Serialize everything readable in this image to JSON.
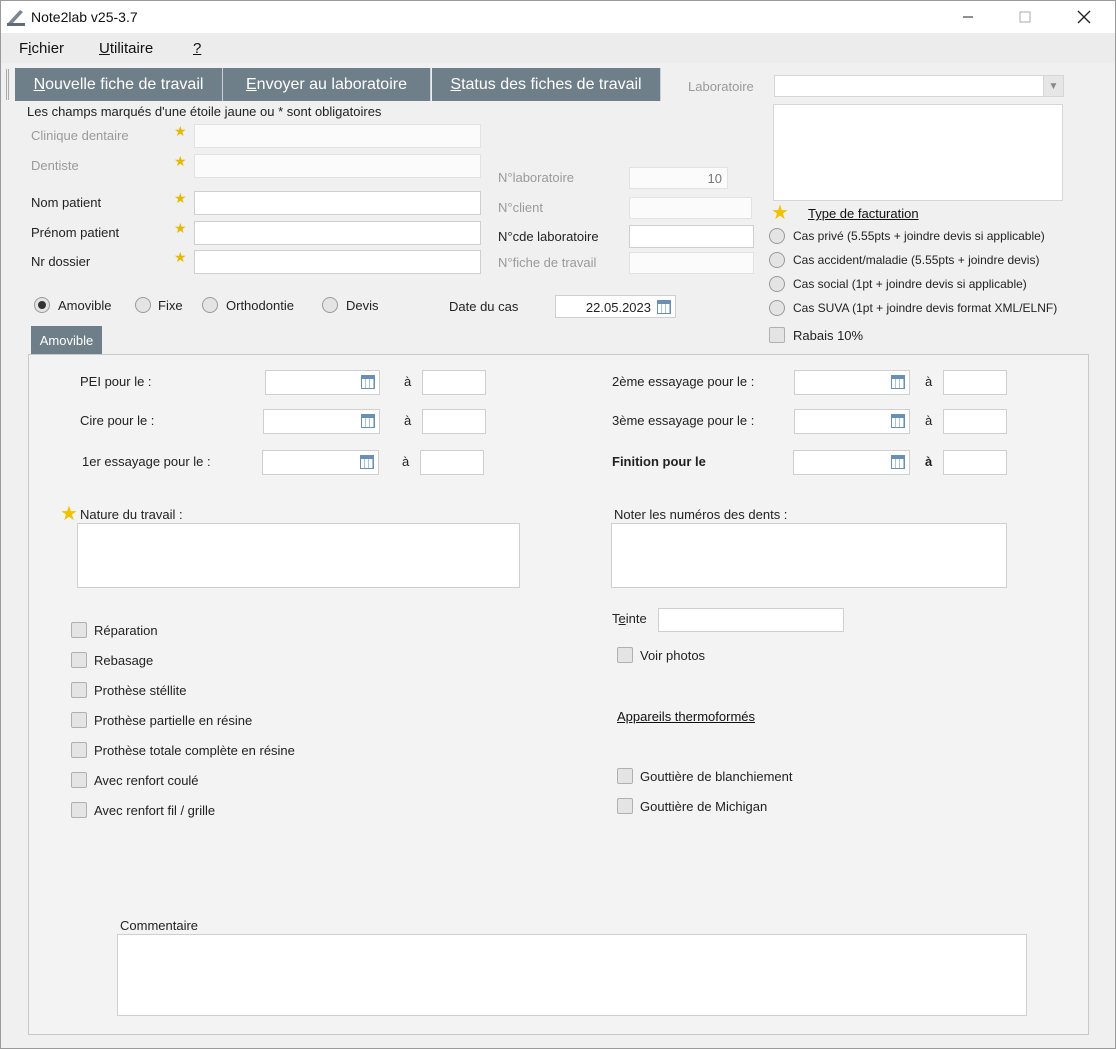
{
  "window": {
    "title": "Note2lab v25-3.7",
    "minimize": "—",
    "maximize": "☐",
    "close": "✕"
  },
  "menu": {
    "fichier_pre": "F",
    "fichier_u": "i",
    "fichier_post": "chier",
    "utilitaire_u": "U",
    "utilitaire_post": "tilitaire",
    "help": "?"
  },
  "tabs": [
    {
      "u": "N",
      "rest": "ouvelle fiche de travail"
    },
    {
      "u": "E",
      "rest": "nvoyer au laboratoire"
    },
    {
      "u": "S",
      "rest": "tatus des fiches de travail"
    }
  ],
  "notice": "Les champs marqués d'une étoile jaune ou * sont obligatoires",
  "fields": {
    "clinique": "Clinique dentaire",
    "dentiste": "Dentiste",
    "nom": "Nom patient",
    "prenom": "Prénom patient",
    "dossier": "Nr dossier",
    "nlabo": "N°laboratoire",
    "nlabo_value": "10",
    "nclient": "N°client",
    "ncde": "N°cde laboratoire",
    "nfiche": "N°fiche de travail",
    "laboratoire": "Laboratoire"
  },
  "facturation": {
    "title": "Type de facturation",
    "options": [
      "Cas privé  (5.55pts + joindre devis si applicable)",
      "Cas accident/maladie (5.55pts + joindre devis)",
      "Cas social (1pt + joindre devis si applicable)",
      "Cas SUVA (1pt + joindre devis format XML/ELNF)"
    ],
    "rabais": "Rabais 10%"
  },
  "work_type": {
    "options": [
      "Amovible",
      "Fixe",
      "Orthodontie",
      "Devis"
    ],
    "selected": "Amovible"
  },
  "date": {
    "label": "Date du cas",
    "value": "22.05.2023"
  },
  "subtab": "Amovible",
  "schedule": {
    "pei": "PEI pour le :",
    "cire": "Cire pour le :",
    "essai1": "1er essayage pour le :",
    "essai2": "2ème essayage pour le :",
    "essai3": "3ème essayage pour le :",
    "finition": "Finition pour le",
    "a": "à"
  },
  "nature": "Nature du travail :",
  "dents": "Noter les numéros des dents :",
  "teinte_pre": "T",
  "teinte_u": "e",
  "teinte_post": "inte",
  "voir_photos": "Voir photos",
  "checks_left": [
    "Réparation",
    "Rebasage",
    "Prothèse stéllite",
    "Prothèse partielle en résine",
    "Prothèse totale complète en résine",
    "Avec renfort coulé",
    "Avec renfort fil / grille"
  ],
  "thermo": {
    "title": "Appareils thermoformés",
    "items": [
      "Gouttière de blanchiement",
      "Gouttière de Michigan"
    ]
  },
  "commentaire": "Commentaire"
}
